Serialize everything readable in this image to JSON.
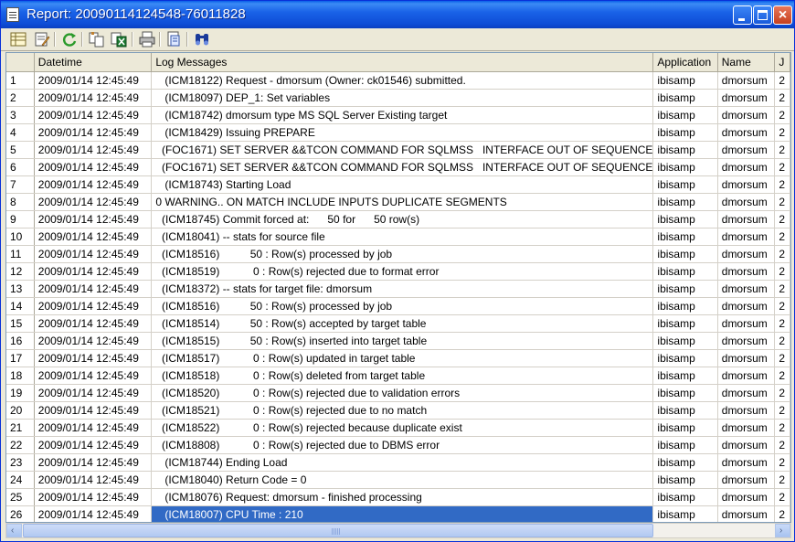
{
  "window": {
    "title": "Report: 20090114124548-76011828"
  },
  "colors": {
    "titlebar": "#0D4CD6",
    "selection": "#316AC5"
  },
  "toolbar": {
    "icons": [
      "grid-view-icon",
      "edit-report-icon",
      "refresh-icon",
      "copy-icon",
      "export-excel-icon",
      "print-icon",
      "page-setup-icon",
      "find-icon"
    ]
  },
  "grid": {
    "columns": [
      "",
      "Datetime",
      "Log Messages",
      "Application",
      "Name",
      "J"
    ],
    "rows": [
      {
        "n": "1",
        "dt": "2009/01/14 12:45:49",
        "msg": "   (ICM18122) Request - dmorsum (Owner: ck01546) submitted.",
        "app": "ibisamp",
        "name": "dmorsum",
        "j": "2"
      },
      {
        "n": "2",
        "dt": "2009/01/14 12:45:49",
        "msg": "   (ICM18097) DEP_1: Set variables",
        "app": "ibisamp",
        "name": "dmorsum",
        "j": "2"
      },
      {
        "n": "3",
        "dt": "2009/01/14 12:45:49",
        "msg": "   (ICM18742) dmorsum type MS SQL Server Existing target",
        "app": "ibisamp",
        "name": "dmorsum",
        "j": "2"
      },
      {
        "n": "4",
        "dt": "2009/01/14 12:45:49",
        "msg": "   (ICM18429) Issuing PREPARE",
        "app": "ibisamp",
        "name": "dmorsum",
        "j": "2"
      },
      {
        "n": "5",
        "dt": "2009/01/14 12:45:49",
        "msg": "  (FOC1671) SET SERVER &&TCON COMMAND FOR SQLMSS   INTERFACE OUT OF SEQUENCE",
        "app": "ibisamp",
        "name": "dmorsum",
        "j": "2"
      },
      {
        "n": "6",
        "dt": "2009/01/14 12:45:49",
        "msg": "  (FOC1671) SET SERVER &&TCON COMMAND FOR SQLMSS   INTERFACE OUT OF SEQUENCE",
        "app": "ibisamp",
        "name": "dmorsum",
        "j": "2"
      },
      {
        "n": "7",
        "dt": "2009/01/14 12:45:49",
        "msg": "   (ICM18743) Starting Load",
        "app": "ibisamp",
        "name": "dmorsum",
        "j": "2"
      },
      {
        "n": "8",
        "dt": "2009/01/14 12:45:49",
        "msg": "0 WARNING.. ON MATCH INCLUDE INPUTS DUPLICATE SEGMENTS",
        "app": "ibisamp",
        "name": "dmorsum",
        "j": "2"
      },
      {
        "n": "9",
        "dt": "2009/01/14 12:45:49",
        "msg": "  (ICM18745) Commit forced at:      50 for      50 row(s)",
        "app": "ibisamp",
        "name": "dmorsum",
        "j": "2"
      },
      {
        "n": "10",
        "dt": "2009/01/14 12:45:49",
        "msg": "  (ICM18041) -- stats for source file",
        "app": "ibisamp",
        "name": "dmorsum",
        "j": "2"
      },
      {
        "n": "11",
        "dt": "2009/01/14 12:45:49",
        "msg": "  (ICM18516)          50 : Row(s) processed by job",
        "app": "ibisamp",
        "name": "dmorsum",
        "j": "2"
      },
      {
        "n": "12",
        "dt": "2009/01/14 12:45:49",
        "msg": "  (ICM18519)           0 : Row(s) rejected due to format error",
        "app": "ibisamp",
        "name": "dmorsum",
        "j": "2"
      },
      {
        "n": "13",
        "dt": "2009/01/14 12:45:49",
        "msg": "  (ICM18372) -- stats for target file: dmorsum",
        "app": "ibisamp",
        "name": "dmorsum",
        "j": "2"
      },
      {
        "n": "14",
        "dt": "2009/01/14 12:45:49",
        "msg": "  (ICM18516)          50 : Row(s) processed by job",
        "app": "ibisamp",
        "name": "dmorsum",
        "j": "2"
      },
      {
        "n": "15",
        "dt": "2009/01/14 12:45:49",
        "msg": "  (ICM18514)          50 : Row(s) accepted by target table",
        "app": "ibisamp",
        "name": "dmorsum",
        "j": "2"
      },
      {
        "n": "16",
        "dt": "2009/01/14 12:45:49",
        "msg": "  (ICM18515)          50 : Row(s) inserted into target table",
        "app": "ibisamp",
        "name": "dmorsum",
        "j": "2"
      },
      {
        "n": "17",
        "dt": "2009/01/14 12:45:49",
        "msg": "  (ICM18517)           0 : Row(s) updated in target table",
        "app": "ibisamp",
        "name": "dmorsum",
        "j": "2"
      },
      {
        "n": "18",
        "dt": "2009/01/14 12:45:49",
        "msg": "  (ICM18518)           0 : Row(s) deleted from target table",
        "app": "ibisamp",
        "name": "dmorsum",
        "j": "2"
      },
      {
        "n": "19",
        "dt": "2009/01/14 12:45:49",
        "msg": "  (ICM18520)           0 : Row(s) rejected due to validation errors",
        "app": "ibisamp",
        "name": "dmorsum",
        "j": "2"
      },
      {
        "n": "20",
        "dt": "2009/01/14 12:45:49",
        "msg": "  (ICM18521)           0 : Row(s) rejected due to no match",
        "app": "ibisamp",
        "name": "dmorsum",
        "j": "2"
      },
      {
        "n": "21",
        "dt": "2009/01/14 12:45:49",
        "msg": "  (ICM18522)           0 : Row(s) rejected because duplicate exist",
        "app": "ibisamp",
        "name": "dmorsum",
        "j": "2"
      },
      {
        "n": "22",
        "dt": "2009/01/14 12:45:49",
        "msg": "  (ICM18808)           0 : Row(s) rejected due to DBMS error",
        "app": "ibisamp",
        "name": "dmorsum",
        "j": "2"
      },
      {
        "n": "23",
        "dt": "2009/01/14 12:45:49",
        "msg": "   (ICM18744) Ending Load",
        "app": "ibisamp",
        "name": "dmorsum",
        "j": "2"
      },
      {
        "n": "24",
        "dt": "2009/01/14 12:45:49",
        "msg": "   (ICM18040) Return Code = 0",
        "app": "ibisamp",
        "name": "dmorsum",
        "j": "2"
      },
      {
        "n": "25",
        "dt": "2009/01/14 12:45:49",
        "msg": "   (ICM18076) Request: dmorsum - finished processing",
        "app": "ibisamp",
        "name": "dmorsum",
        "j": "2"
      },
      {
        "n": "26",
        "dt": "2009/01/14 12:45:49",
        "msg": "   (ICM18007) CPU Time : 210",
        "app": "ibisamp",
        "name": "dmorsum",
        "j": "2",
        "selected": true
      }
    ]
  },
  "scrollbar": {
    "left_arrow": "‹",
    "right_arrow": "›"
  }
}
